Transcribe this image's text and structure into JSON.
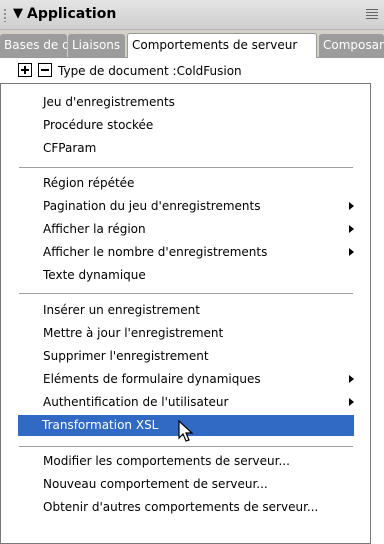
{
  "panel": {
    "title": "Application",
    "collapse_glyph": "▼",
    "options_icon": "panel-options-icon"
  },
  "tabs": [
    {
      "label": "Bases de données",
      "active": false
    },
    {
      "label": "Liaisons",
      "active": false
    },
    {
      "label": "Comportements de serveur",
      "active": true
    },
    {
      "label": "Composants",
      "active": false
    }
  ],
  "toolbar": {
    "add_icon": "plus-icon",
    "remove_icon": "minus-icon",
    "document_type": "Type de document :ColdFusion"
  },
  "menu": {
    "items": [
      {
        "label": "Jeu d'enregistrements",
        "submenu": false
      },
      {
        "label": "Procédure stockée",
        "submenu": false
      },
      {
        "label": "CFParam",
        "submenu": false
      },
      {
        "label": "Région répétée",
        "submenu": false
      },
      {
        "label": "Pagination du jeu d'enregistrements",
        "submenu": true
      },
      {
        "label": "Afficher la région",
        "submenu": true
      },
      {
        "label": "Afficher le nombre d'enregistrements",
        "submenu": true
      },
      {
        "label": "Texte dynamique",
        "submenu": false
      },
      {
        "label": "Insérer un enregistrement",
        "submenu": false
      },
      {
        "label": "Mettre à jour l'enregistrement",
        "submenu": false
      },
      {
        "label": "Supprimer l'enregistrement",
        "submenu": false
      },
      {
        "label": "Eléments de formulaire dynamiques",
        "submenu": true
      },
      {
        "label": "Authentification de l'utilisateur",
        "submenu": true
      },
      {
        "label": "Transformation XSL",
        "submenu": false,
        "highlighted": true
      },
      {
        "label": "Modifier les comportements de serveur...",
        "submenu": false
      },
      {
        "label": "Nouveau comportement de serveur...",
        "submenu": false
      },
      {
        "label": "Obtenir d'autres comportements de serveur...",
        "submenu": false
      }
    ]
  },
  "colors": {
    "highlight": "#316ac5",
    "tab_inactive": "#9c9c9c"
  }
}
